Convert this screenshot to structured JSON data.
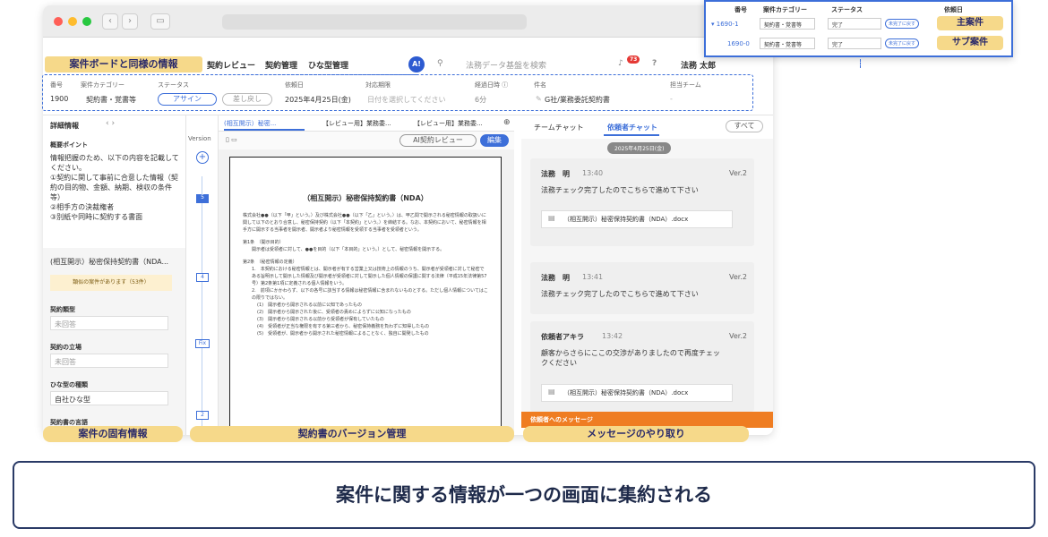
{
  "nav": {
    "items": [
      "契約レビュー",
      "契約管理",
      "ひな型管理"
    ],
    "search_placeholder": "法務データ基盤を検索",
    "user": "法務 太郎",
    "notification_count": "73",
    "logo": "A!"
  },
  "info": {
    "headers": [
      "番号",
      "案件カテゴリー",
      "ステータス",
      "依頼日",
      "対応期限",
      "経過日時 ⓘ",
      "件名",
      "担当チーム"
    ],
    "number": "1900",
    "category": "契約書・覚書等",
    "status_active": "アサイン",
    "status_back": "差し戻し",
    "request_date": "2025年4月25日(金)",
    "deadline_placeholder": "日付を選択してください",
    "elapsed": "6分",
    "subject": "G社/業務委託契約書",
    "team": "-"
  },
  "left": {
    "header": "詳細情報",
    "overview_title": "概要ポイント",
    "overview": [
      "情報把握のため、以下の内容を記載してください。",
      "①契約に関して事前に合意した情報（契約の目的物、金額、納期、検収の条件等）",
      "②相手方の決裁権者",
      "③別紙や同時に契約する書面"
    ],
    "doc_name": "(相互開示）秘密保持契約書（NDA...",
    "similar": "類似の案件があります（53件）",
    "contract_type_label": "契約類型",
    "contract_type_value": "未回答",
    "position_label": "契約の立場",
    "position_value": "未回答",
    "template_label": "ひな型の種類",
    "template_value": "自社ひな型",
    "more_label": "契約書の言語"
  },
  "version": {
    "label": "Version",
    "nodes": [
      "5",
      "4",
      "Fix",
      "2"
    ]
  },
  "doc": {
    "tabs": [
      "(相互開示）秘密...",
      "【レビュー用】業務委...",
      "【レビュー用】業務委..."
    ],
    "ai_button": "AI契約レビュー",
    "edit_button": "編集",
    "title": "（相互開示）秘密保持契約書（NDA）",
    "para1": "株式会社●●（以下「甲」という。）及び株式会社●●（以下「乙」という。）は、甲乙間で開示される秘密情報の取扱いに関して以下のとおり合意し、秘密保持契約（以下「本契約」という。）を締結する。なお、本契約において、秘密情報を相手方に開示する当事者を開示者、開示者より秘密情報を受領する当事者を受領者という。",
    "art1": "第1条　（開示目的）",
    "art1_body": "開示者は受領者に対して、●●を目的（以下「本目的」という。）として、秘密情報を開示する。",
    "art2": "第2条　（秘密情報の定義）",
    "art2_items": [
      "1.　本契約における秘密情報とは、開示者が有する営業上又は技術上の情報のうち、開示者が受領者に対して秘密である旨明示して開示した情報及び開示者が受領者に対して開示した個人情報の保護に関する法律（平成15年法律第57号）第2条第1項に定義される個人情報をいう。",
      "2.　前項にかかわらず、以下の各号に該当する情報は秘密情報に含まれないものとする。ただし個人情報についてはこの限りではない。",
      "(1)　開示者から開示される以前に公知であったもの",
      "(2)　開示者から開示された後に、受領者の責めによらずに公知になったもの",
      "(3)　開示者から開示される以前から受領者が保有していたもの",
      "(4)　受領者が正当な権限を有する第三者から、秘密保持義務を負わずに知得したもの",
      "(5)　受領者が、開示者から開示された秘密情報によることなく、独自に開発したもの"
    ]
  },
  "chat": {
    "tabs": [
      "チームチャット",
      "依頼者チャット"
    ],
    "all_button": "すべて",
    "date": "2025年4月25日(金)",
    "messages": [
      {
        "name": "法務　明",
        "time": "13:40",
        "ver": "Ver.2",
        "text": "法務チェック完了したのでこちらで進めて下さい",
        "attachment": "（相互開示）秘密保持契約書（NDA）.docx"
      },
      {
        "name": "法務　明",
        "time": "13:41",
        "ver": "Ver.2",
        "text": "法務チェック完了したのでこちらで進めて下さい",
        "attachment": ""
      },
      {
        "name": "依頼者アキラ",
        "time": "13:42",
        "ver": "Ver.2",
        "text": "顧客からさらにここの交渉がありましたので再度チェックください",
        "attachment": "（相互開示）秘密保持契約書（NDA）.docx"
      }
    ],
    "footer": "依頼者へのメッセージ"
  },
  "popup": {
    "headers": [
      "番号",
      "案件カテゴリー",
      "ステータス",
      "依頼日"
    ],
    "rows": [
      {
        "no": "▾ 1690-1",
        "cat": "契約書・覚書等",
        "status": "完了",
        "badge": "未完了に戻す",
        "tag": "主案件"
      },
      {
        "no": "1690-0",
        "cat": "契約書・覚書等",
        "status": "完了",
        "badge": "未完了に戻す",
        "tag": "サブ案件"
      }
    ]
  },
  "labels": {
    "board": "案件ボードと同様の情報",
    "case": "案件の固有情報",
    "version": "契約書のバージョン管理",
    "message": "メッセージのやり取り"
  },
  "banner": "案件に関する情報が一つの画面に集約される"
}
